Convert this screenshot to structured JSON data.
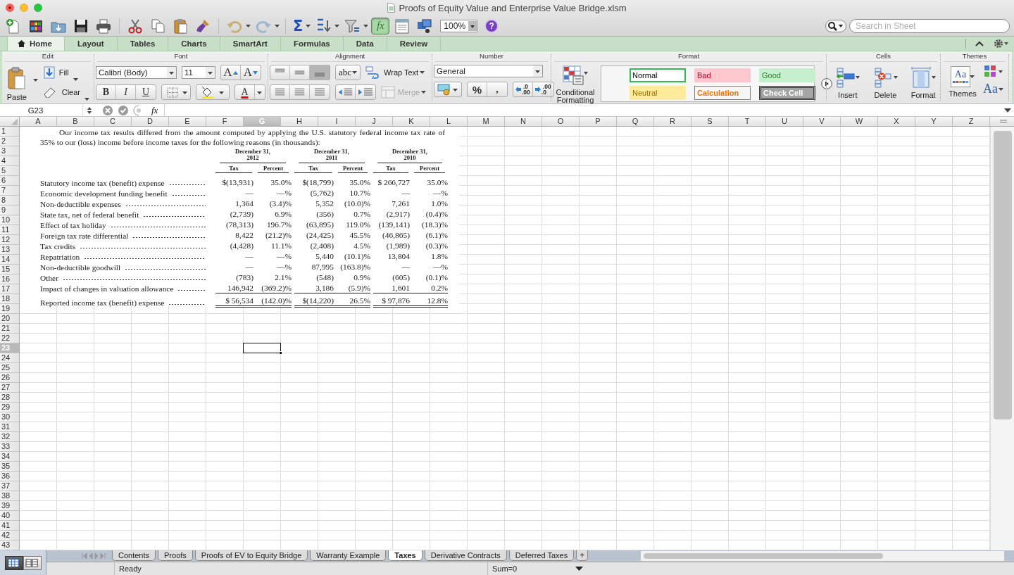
{
  "window": {
    "title": "Proofs of Equity Value and Enterprise Value Bridge.xlsm"
  },
  "toolbar": {
    "sum_label": "Σ",
    "formula_label": "fx",
    "formula_on": true,
    "zoom": "100%",
    "help_label": "?",
    "search_placeholder": "Search in Sheet"
  },
  "ribbon_tabs": [
    {
      "label": "Home",
      "selected": true
    },
    {
      "label": "Layout",
      "selected": false
    },
    {
      "label": "Tables",
      "selected": false
    },
    {
      "label": "Charts",
      "selected": false
    },
    {
      "label": "SmartArt",
      "selected": false
    },
    {
      "label": "Formulas",
      "selected": false
    },
    {
      "label": "Data",
      "selected": false
    },
    {
      "label": "Review",
      "selected": false
    }
  ],
  "ribbon": {
    "edit": {
      "title": "Edit",
      "paste": "Paste",
      "fill": "Fill",
      "clear": "Clear"
    },
    "font": {
      "title": "Font",
      "font_name": "Calibri (Body)",
      "font_size": "11",
      "grow": "A",
      "shrink": "A",
      "bold": "B",
      "italic": "I",
      "underline": "U",
      "font_color": "A"
    },
    "alignment": {
      "title": "Alignment",
      "orientation": "abc",
      "wrap_text": "Wrap Text",
      "merge": "Merge",
      "merge_disabled": true
    },
    "number": {
      "title": "Number",
      "format": "General",
      "percent": "%",
      "comma": ",",
      "increase_decimal": {
        "top": ".0",
        "bottom": ".00"
      },
      "decrease_decimal": {
        "top": ".00",
        "bottom": ".0"
      }
    },
    "format": {
      "title": "Format",
      "conditional": "Conditional Formatting",
      "styles": [
        {
          "label": "Normal",
          "kind": "normal",
          "selected": true
        },
        {
          "label": "Bad",
          "kind": "bad",
          "selected": false
        },
        {
          "label": "Good",
          "kind": "good",
          "selected": false
        },
        {
          "label": "Neutral",
          "kind": "neutral",
          "selected": false
        },
        {
          "label": "Calculation",
          "kind": "calculation",
          "selected": false
        },
        {
          "label": "Check Cell",
          "kind": "check",
          "selected": false
        }
      ]
    },
    "cells": {
      "title": "Cells",
      "buttons": [
        "Insert",
        "Delete",
        "Format"
      ]
    },
    "themes": {
      "title": "Themes",
      "themes": "Themes",
      "theme_icon_text": "Aa",
      "fonts": "Aa"
    }
  },
  "formula_bar": {
    "name_box": "G23",
    "fx": "fx"
  },
  "columns": [
    {
      "label": "A",
      "selected": false
    },
    {
      "label": "B",
      "selected": false
    },
    {
      "label": "C",
      "selected": false
    },
    {
      "label": "D",
      "selected": false
    },
    {
      "label": "E",
      "selected": false
    },
    {
      "label": "F",
      "selected": false
    },
    {
      "label": "G",
      "selected": true
    },
    {
      "label": "H",
      "selected": false
    },
    {
      "label": "I",
      "selected": false
    },
    {
      "label": "J",
      "selected": false
    },
    {
      "label": "K",
      "selected": false
    },
    {
      "label": "L",
      "selected": false
    },
    {
      "label": "M",
      "selected": false
    },
    {
      "label": "N",
      "selected": false
    },
    {
      "label": "O",
      "selected": false
    },
    {
      "label": "P",
      "selected": false
    },
    {
      "label": "Q",
      "selected": false
    },
    {
      "label": "R",
      "selected": false
    },
    {
      "label": "S",
      "selected": false
    },
    {
      "label": "T",
      "selected": false
    },
    {
      "label": "U",
      "selected": false
    },
    {
      "label": "V",
      "selected": false
    },
    {
      "label": "W",
      "selected": false
    },
    {
      "label": "X",
      "selected": false
    },
    {
      "label": "Y",
      "selected": false
    },
    {
      "label": "Z",
      "selected": false
    }
  ],
  "rows": [
    {
      "label": "1",
      "selected": false
    },
    {
      "label": "2",
      "selected": false
    },
    {
      "label": "3",
      "selected": false
    },
    {
      "label": "4",
      "selected": false
    },
    {
      "label": "5",
      "selected": false
    },
    {
      "label": "6",
      "selected": false
    },
    {
      "label": "7",
      "selected": false
    },
    {
      "label": "8",
      "selected": false
    },
    {
      "label": "9",
      "selected": false
    },
    {
      "label": "10",
      "selected": false
    },
    {
      "label": "11",
      "selected": false
    },
    {
      "label": "12",
      "selected": false
    },
    {
      "label": "13",
      "selected": false
    },
    {
      "label": "14",
      "selected": false
    },
    {
      "label": "15",
      "selected": false
    },
    {
      "label": "16",
      "selected": false
    },
    {
      "label": "17",
      "selected": false
    },
    {
      "label": "18",
      "selected": false
    },
    {
      "label": "19",
      "selected": false
    },
    {
      "label": "20",
      "selected": false
    },
    {
      "label": "21",
      "selected": false
    },
    {
      "label": "22",
      "selected": false
    },
    {
      "label": "23",
      "selected": true
    },
    {
      "label": "24",
      "selected": false
    },
    {
      "label": "25",
      "selected": false
    },
    {
      "label": "26",
      "selected": false
    },
    {
      "label": "27",
      "selected": false
    },
    {
      "label": "28",
      "selected": false
    },
    {
      "label": "29",
      "selected": false
    },
    {
      "label": "30",
      "selected": false
    },
    {
      "label": "31",
      "selected": false
    },
    {
      "label": "32",
      "selected": false
    },
    {
      "label": "33",
      "selected": false
    },
    {
      "label": "34",
      "selected": false
    },
    {
      "label": "35",
      "selected": false
    },
    {
      "label": "36",
      "selected": false
    },
    {
      "label": "37",
      "selected": false
    },
    {
      "label": "38",
      "selected": false
    },
    {
      "label": "39",
      "selected": false
    },
    {
      "label": "40",
      "selected": false
    },
    {
      "label": "41",
      "selected": false
    },
    {
      "label": "42",
      "selected": false
    },
    {
      "label": "43",
      "selected": false
    }
  ],
  "document": {
    "intro": "Our income tax results differed from the amount computed by applying the U.S. statutory federal income tax rate of 35% to our (loss) income before income taxes for the following reasons (in thousands):",
    "periods": [
      {
        "label": "December 31,",
        "year": "2012"
      },
      {
        "label": "December 31,",
        "year": "2011"
      },
      {
        "label": "December 31,",
        "year": "2010"
      }
    ],
    "column_headers": [
      "Tax",
      "Percent",
      "Tax",
      "Percent",
      "Tax",
      "Percent"
    ],
    "lines": [
      {
        "label": "Statutory income tax (benefit) expense",
        "kind": "normal",
        "values": [
          "$(13,931)",
          "35.0%",
          "$(18,799)",
          "35.0%",
          "$ 266,727",
          "35.0%"
        ]
      },
      {
        "label": "Economic development funding benefit",
        "kind": "normal",
        "values": [
          "—",
          "—%",
          "(5,762)",
          "10.7%",
          "—",
          "—%"
        ]
      },
      {
        "label": "Non-deductible expenses",
        "kind": "normal",
        "values": [
          "1,364",
          "(3.4)%",
          "5,352",
          "(10.0)%",
          "7,261",
          "1.0%"
        ]
      },
      {
        "label": "State tax, net of federal benefit",
        "kind": "normal",
        "values": [
          "(2,739)",
          "6.9%",
          "(356)",
          "0.7%",
          "(2,917)",
          "(0.4)%"
        ]
      },
      {
        "label": "Effect of tax holiday",
        "kind": "normal",
        "values": [
          "(78,313)",
          "196.7%",
          "(63,895)",
          "119.0%",
          "(139,141)",
          "(18.3)%"
        ]
      },
      {
        "label": "Foreign tax rate differential",
        "kind": "normal",
        "values": [
          "8,422",
          "(21.2)%",
          "(24,425)",
          "45.5%",
          "(46,865)",
          "(6.1)%"
        ]
      },
      {
        "label": "Tax credits",
        "kind": "normal",
        "values": [
          "(4,428)",
          "11.1%",
          "(2,408)",
          "4.5%",
          "(1,989)",
          "(0.3)%"
        ]
      },
      {
        "label": "Repatriation",
        "kind": "normal",
        "values": [
          "—",
          "—%",
          "5,440",
          "(10.1)%",
          "13,804",
          "1.8%"
        ]
      },
      {
        "label": "Non-deductible goodwill",
        "kind": "normal",
        "values": [
          "—",
          "—%",
          "87,995",
          "(163.8)%",
          "—",
          "—%"
        ]
      },
      {
        "label": "Other",
        "kind": "normal",
        "values": [
          "(783)",
          "2.1%",
          "(548)",
          "0.9%",
          "(605)",
          "(0.1)%"
        ]
      },
      {
        "label": "Impact of changes in valuation allowance",
        "kind": "subtotal",
        "values": [
          "146,942",
          "(369.2)%",
          "3,186",
          "(5.9)%",
          "1,601",
          "0.2%"
        ]
      },
      {
        "label": "Reported income tax (benefit) expense",
        "kind": "total",
        "values": [
          "$ 56,534",
          "(142.0)%",
          "$(14,220)",
          "26.5%",
          "$ 97,876",
          "12.8%"
        ]
      }
    ]
  },
  "sheet_tabs": [
    {
      "label": "Contents",
      "selected": false
    },
    {
      "label": "Proofs",
      "selected": false
    },
    {
      "label": "Proofs of EV to Equity Bridge",
      "selected": false
    },
    {
      "label": "Warranty Example",
      "selected": false
    },
    {
      "label": "Taxes",
      "selected": true
    },
    {
      "label": "Derivative Contracts",
      "selected": false
    },
    {
      "label": "Deferred Taxes",
      "selected": false
    }
  ],
  "add_sheet": "+",
  "views": [
    {
      "kind": "normal",
      "selected": true
    },
    {
      "kind": "page_layout",
      "selected": false
    }
  ],
  "status_bar": {
    "status": "Ready",
    "sum": "Sum=0"
  }
}
